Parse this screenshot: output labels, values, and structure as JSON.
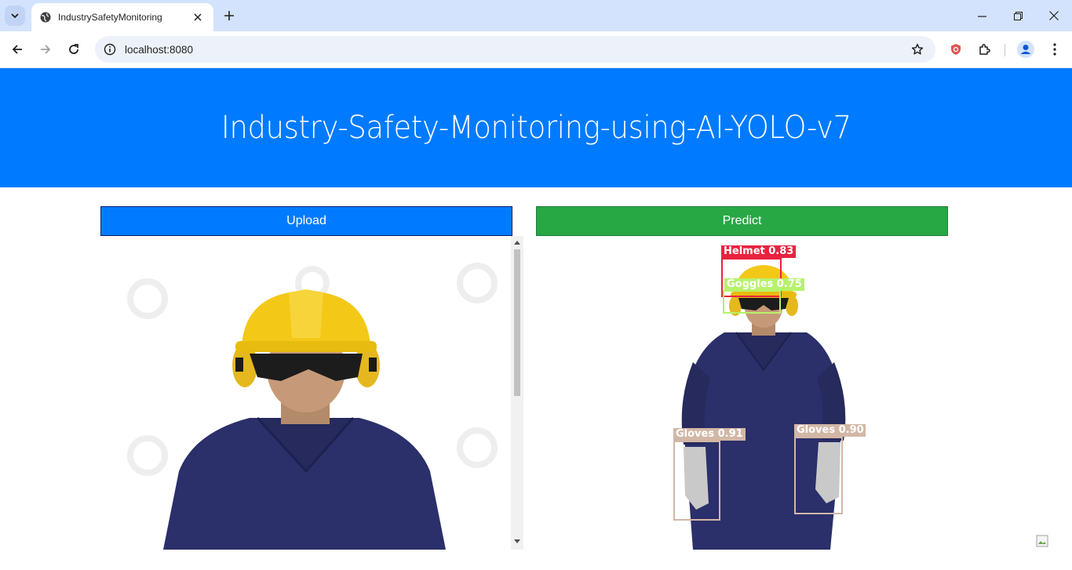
{
  "browser": {
    "tab_title": "IndustrySafetyMonitoring",
    "url": "localhost:8080"
  },
  "page": {
    "title": "Industry-Safety-Monitoring-using-AI-YOLO-v7",
    "upload_label": "Upload",
    "predict_label": "Predict"
  },
  "detections": [
    {
      "label": "Helmet 0.83",
      "color": "#e8233f"
    },
    {
      "label": "Goggles 0.75",
      "color": "#b7f26b"
    },
    {
      "label": "Gloves 0.91",
      "color": "#d2b7a6"
    },
    {
      "label": "Gloves 0.90",
      "color": "#d2b7a6"
    }
  ],
  "colors": {
    "header_bg": "#007bff",
    "upload_bg": "#007bff",
    "predict_bg": "#28a745",
    "tabstrip_bg": "#d3e3fd"
  }
}
